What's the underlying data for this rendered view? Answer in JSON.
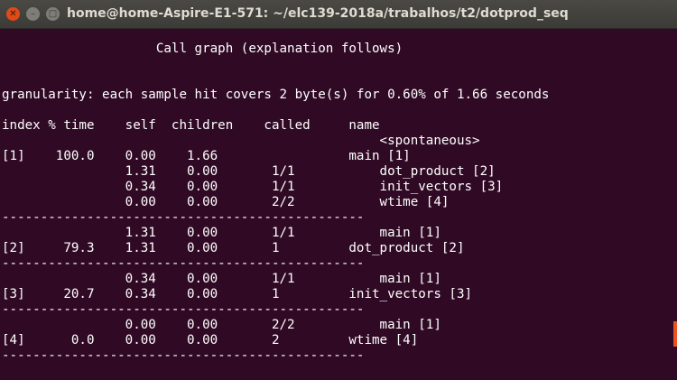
{
  "window": {
    "title": "home@home-Aspire-E1-571: ~/elc139-2018a/trabalhos/t2/dotprod_seq",
    "buttons": {
      "close": "✕",
      "minimize": "–",
      "maximize": "□"
    }
  },
  "terminal": {
    "lines": [
      "                    Call graph (explanation follows)",
      "",
      "",
      "granularity: each sample hit covers 2 byte(s) for 0.60% of 1.66 seconds",
      "",
      "index % time    self  children    called     name",
      "                                                 <spontaneous>",
      "[1]    100.0    0.00    1.66                 main [1]",
      "                1.31    0.00       1/1           dot_product [2]",
      "                0.34    0.00       1/1           init_vectors [3]",
      "                0.00    0.00       2/2           wtime [4]",
      "-----------------------------------------------",
      "                1.31    0.00       1/1           main [1]",
      "[2]     79.3    1.31    0.00       1         dot_product [2]",
      "-----------------------------------------------",
      "                0.34    0.00       1/1           main [1]",
      "[3]     20.7    0.34    0.00       1         init_vectors [3]",
      "-----------------------------------------------",
      "                0.00    0.00       2/2           main [1]",
      "[4]      0.0    0.00    0.00       2         wtime [4]",
      "-----------------------------------------------"
    ]
  },
  "colors": {
    "background": "#300a24",
    "text": "#ffffff",
    "titlebar": "#3c3b37",
    "close_button": "#df4a16",
    "scroll_marker": "#e95420"
  }
}
